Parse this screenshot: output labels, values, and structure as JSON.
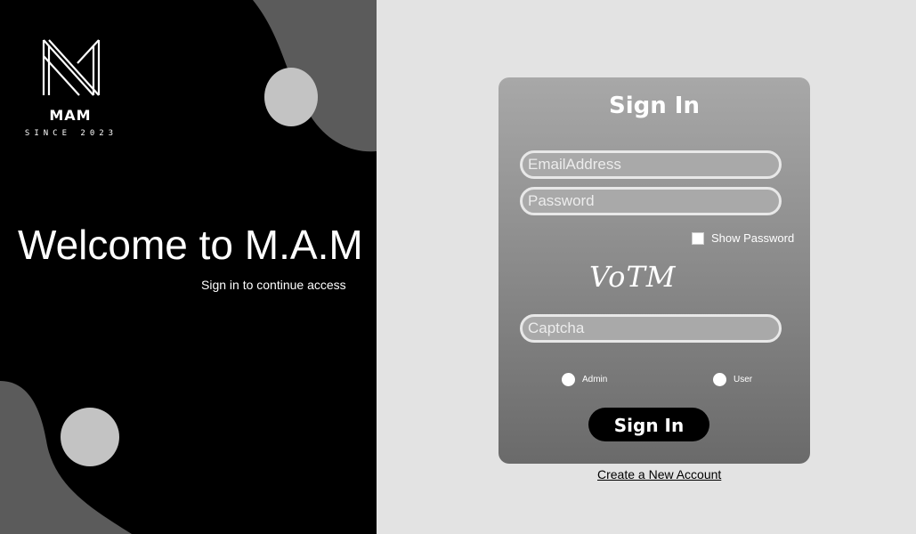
{
  "brand": {
    "name": "MAM",
    "tagline": "SINCE 2023"
  },
  "welcome": {
    "title": "Welcome to M.A.M",
    "subtitle": "Sign in to continue access"
  },
  "form": {
    "title": "Sign In",
    "email_placeholder": "EmailAddress",
    "password_placeholder": "Password",
    "show_password_label": "Show Password",
    "show_password_checked": false,
    "captcha_text": "VoTM",
    "captcha_placeholder": "Captcha",
    "roles": [
      {
        "label": "Admin",
        "selected": false
      },
      {
        "label": "User",
        "selected": false
      }
    ],
    "submit_label": "Sign In",
    "create_account_label": "Create a New Account"
  },
  "colors": {
    "left_panel_bg": "#000000",
    "page_bg": "#e3e3e3",
    "card_top": "#a8a8a8",
    "card_bottom": "#6a6a6a",
    "decor_shape": "#5b5b5b",
    "decor_circle": "#c3c3c3"
  },
  "icons": {
    "logo": "mam-monogram-logo",
    "show_password": "checkbox-icon",
    "role": "radio-icon"
  }
}
